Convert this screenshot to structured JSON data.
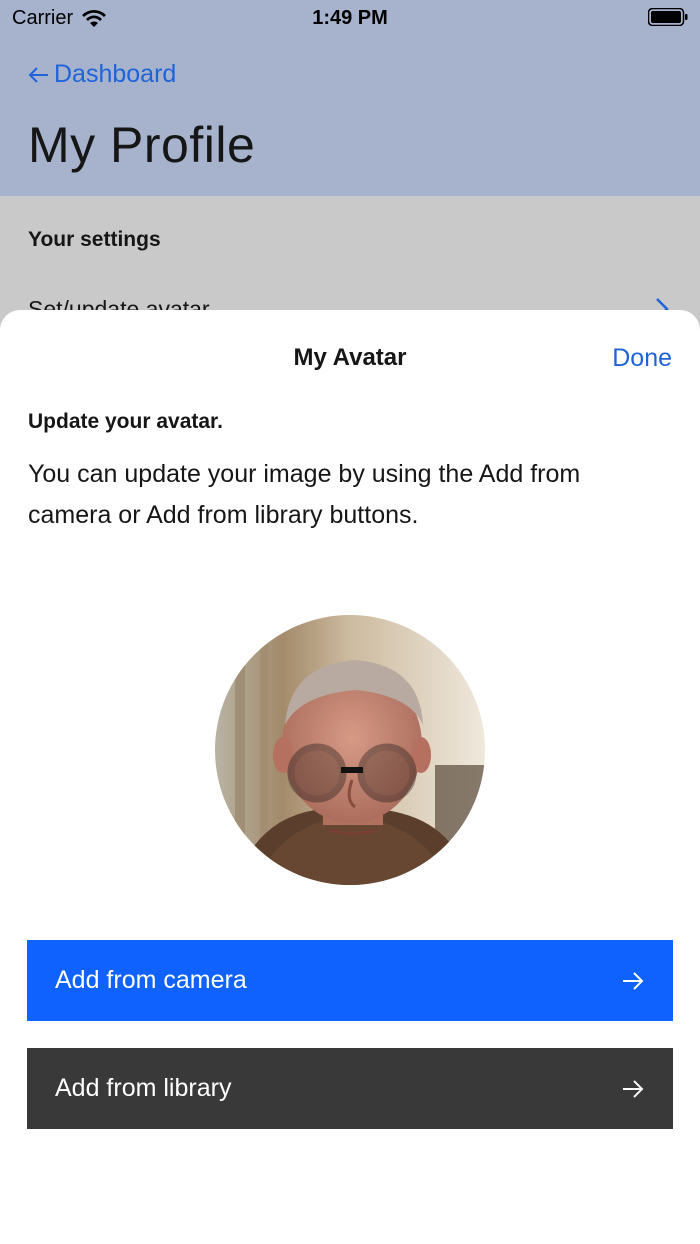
{
  "status_bar": {
    "carrier": "Carrier",
    "time": "1:49 PM"
  },
  "nav": {
    "back_label": "Dashboard",
    "page_title": "My Profile"
  },
  "background": {
    "settings_heading": "Your settings",
    "settings_row_label": "Set/update avatar"
  },
  "sheet": {
    "title": "My Avatar",
    "done_label": "Done",
    "subtitle": "Update your avatar.",
    "description": "You can update your image by using the Add from camera or Add from library buttons."
  },
  "buttons": {
    "camera_label": "Add from camera",
    "library_label": "Add from library"
  },
  "colors": {
    "accent": "#0f62fe",
    "link": "#1f63d9",
    "dark_button": "#393939",
    "header_bg": "#a7b3cd"
  },
  "icons": [
    "wifi-icon",
    "battery-icon",
    "back-arrow-icon",
    "chevron-right-icon",
    "arrow-right-icon"
  ]
}
